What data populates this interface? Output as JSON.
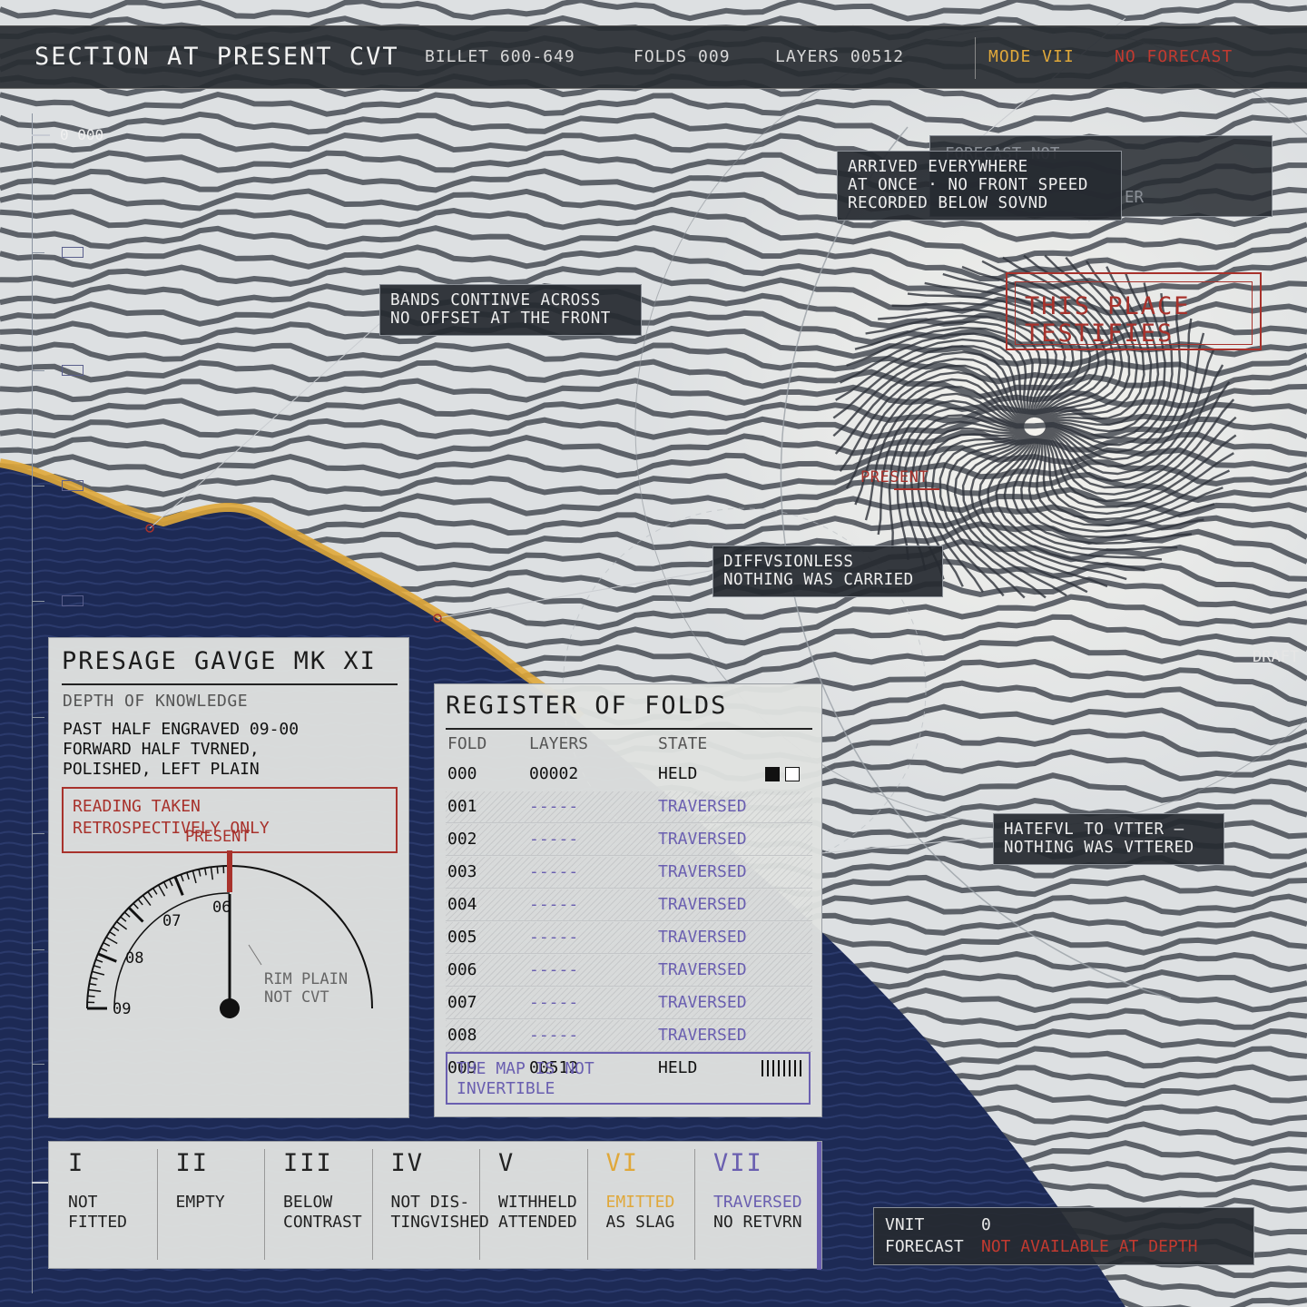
{
  "colors": {
    "amber": "#e0a83a",
    "red": "#a8322c",
    "violet": "#6a5fb0",
    "panel": "#e0e2e0",
    "dark": "#282c32",
    "navy": "#1d2a55"
  },
  "header": {
    "title": "SECTION AT PRESENT CVT",
    "billet": "BILLET 600-649",
    "folds": "FOLDS 009",
    "layers": "LAYERS 00512",
    "mode": "MODE VII",
    "forecast": "NO FORECAST"
  },
  "ruler": {
    "top_label": "0 000"
  },
  "callouts": {
    "behind_top": "FORECAST NOT",
    "behind_tail": "ER",
    "arrived": "ARRIVED EVERYWHERE\nAT ONCE · NO FRONT SPEED\nRECORDED BELOW SOVND",
    "bands": "BANDS CONTINVE ACROSS\nNO OFFSET AT THE FRONT",
    "diffusionless": "DIFFVSIONLESS\nNOTHING WAS CARRIED",
    "hateful": "HATEFVL TO VTTER —\nNOTHING WAS VTTERED"
  },
  "testifies": "THIS PLACE\nTESTIFIES",
  "present_mark": "PRESENT",
  "edge_label": "DRAFT",
  "gauge": {
    "title": "PRESAGE GAVGE MK XI",
    "subtitle": "DEPTH OF KNOWLEDGE",
    "description": "PAST HALF ENGRAVED 09-00\nFORWARD HALF TVRNED,\nPOLISHED, LEFT PLAIN",
    "warning": "READING TAKEN\nRETROSPECTIVELY ONLY",
    "present_label": "PRESENT",
    "scale_labels": [
      "09",
      "08",
      "07",
      "06"
    ],
    "rim_note_1": "RIM PLAIN",
    "rim_note_2": "NOT CVT",
    "needle_value": "00"
  },
  "register": {
    "title": "REGISTER OF FOLDS",
    "columns": [
      "FOLD",
      "LAYERS",
      "STATE"
    ],
    "rows": [
      {
        "fold": "000",
        "layers": "00002",
        "state": "HELD",
        "kind": "held-swatch"
      },
      {
        "fold": "001",
        "layers": "-----",
        "state": "TRAVERSED",
        "kind": "trav"
      },
      {
        "fold": "002",
        "layers": "-----",
        "state": "TRAVERSED",
        "kind": "trav"
      },
      {
        "fold": "003",
        "layers": "-----",
        "state": "TRAVERSED",
        "kind": "trav"
      },
      {
        "fold": "004",
        "layers": "-----",
        "state": "TRAVERSED",
        "kind": "trav"
      },
      {
        "fold": "005",
        "layers": "-----",
        "state": "TRAVERSED",
        "kind": "trav"
      },
      {
        "fold": "006",
        "layers": "-----",
        "state": "TRAVERSED",
        "kind": "trav"
      },
      {
        "fold": "007",
        "layers": "-----",
        "state": "TRAVERSED",
        "kind": "trav"
      },
      {
        "fold": "008",
        "layers": "-----",
        "state": "TRAVERSED",
        "kind": "trav"
      },
      {
        "fold": "009",
        "layers": "00512",
        "state": "HELD",
        "kind": "held-barcode"
      }
    ],
    "note": "THE MAP IS NOT\nINVERTIBLE"
  },
  "classes": [
    {
      "numeral": "I",
      "label": "NOT\nFITTED",
      "color": "#222222"
    },
    {
      "numeral": "II",
      "label": "EMPTY",
      "color": "#222222"
    },
    {
      "numeral": "III",
      "label": "BELOW\nCONTRAST",
      "color": "#222222"
    },
    {
      "numeral": "IV",
      "label": "NOT DIS-\nTINGVISHED",
      "color": "#222222"
    },
    {
      "numeral": "V",
      "label": "WITHHELD\nATTENDED",
      "color": "#222222"
    },
    {
      "numeral": "VI",
      "label_top": "EMITTED",
      "label_bottom": "AS SLAG",
      "color": "#e0a83a"
    },
    {
      "numeral": "VII",
      "label_top": "TRAVERSED",
      "label_bottom": "NO RETVRN",
      "color": "#6a5fb0"
    }
  ],
  "unit": {
    "unit_label": "VNIT",
    "unit_value": "0",
    "forecast_label": "FORECAST",
    "forecast_value": "NOT AVAILABLE AT DEPTH"
  }
}
